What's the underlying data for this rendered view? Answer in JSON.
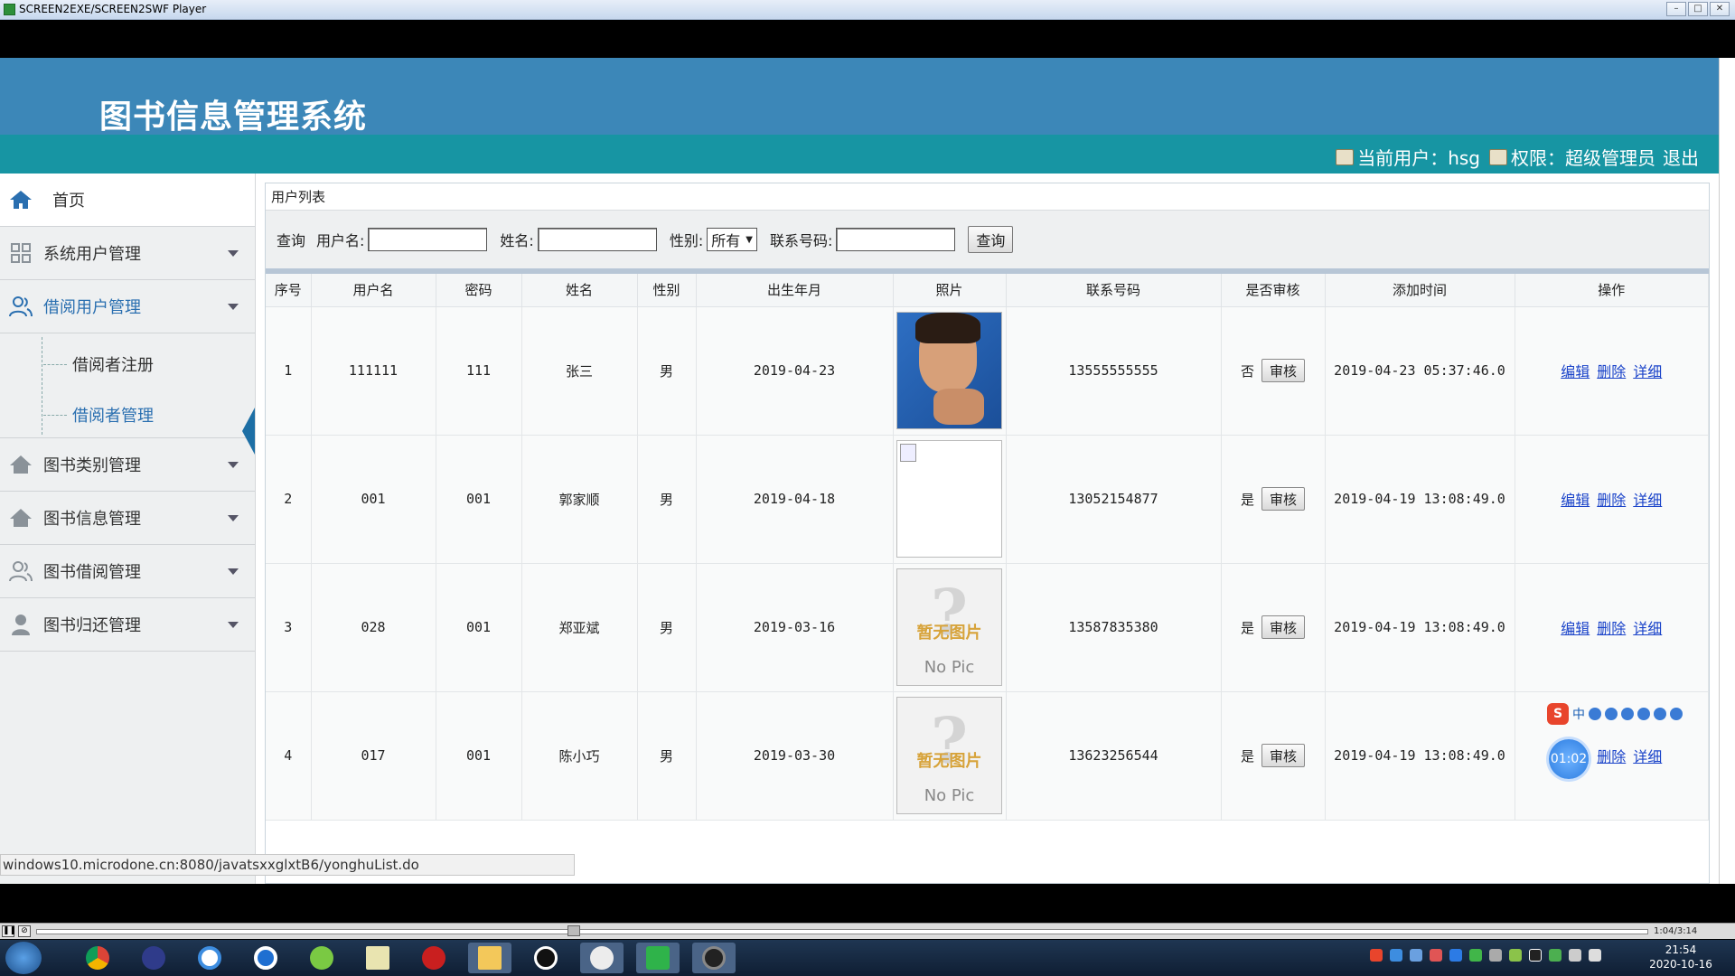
{
  "window": {
    "title": "SCREEN2EXE/SCREEN2SWF Player",
    "buttons": [
      "–",
      "□",
      "✕"
    ]
  },
  "header": {
    "system_title": "图书信息管理系统"
  },
  "userbar": {
    "current_user": "当前用户：hsg",
    "role": "权限：超级管理员",
    "logout": "退出"
  },
  "sidebar": {
    "home": "首页",
    "items": [
      {
        "label": "系统用户管理",
        "icon": "grid-icon"
      },
      {
        "label": "借阅用户管理",
        "icon": "users-icon"
      },
      {
        "label": "图书类别管理",
        "icon": "house-icon"
      },
      {
        "label": "图书信息管理",
        "icon": "house-icon"
      },
      {
        "label": "图书借阅管理",
        "icon": "users-icon"
      },
      {
        "label": "图书归还管理",
        "icon": "user-icon"
      }
    ],
    "subitems": [
      "借阅者注册",
      "借阅者管理"
    ],
    "active_subitem": "借阅者管理"
  },
  "panel": {
    "title": "用户列表",
    "search": {
      "prefix": "查询",
      "username_label": "用户名:",
      "name_label": "姓名:",
      "gender_label": "性别:",
      "gender_selected": "所有",
      "phone_label": "联系号码:",
      "button": "查询"
    },
    "columns": [
      "序号",
      "用户名",
      "密码",
      "姓名",
      "性别",
      "出生年月",
      "照片",
      "联系号码",
      "是否审核",
      "添加时间",
      "操作"
    ],
    "rows": [
      {
        "no": "1",
        "username": "111111",
        "password": "111",
        "name": "张三",
        "gender": "男",
        "birth": "2019-04-23",
        "photo": "face-photo",
        "phone": "13555555555",
        "audited": "否",
        "audit_btn": "审核",
        "added": "2019-04-23 05:37:46.0",
        "ops": [
          "编辑",
          "删除",
          "详细"
        ]
      },
      {
        "no": "2",
        "username": "001",
        "password": "001",
        "name": "郭家顺",
        "gender": "男",
        "birth": "2019-04-18",
        "photo": "broken-image",
        "phone": "13052154877",
        "audited": "是",
        "audit_btn": "审核",
        "added": "2019-04-19 13:08:49.0",
        "ops": [
          "编辑",
          "删除",
          "详细"
        ]
      },
      {
        "no": "3",
        "username": "028",
        "password": "001",
        "name": "郑亚斌",
        "gender": "男",
        "birth": "2019-03-16",
        "photo": "no-pic",
        "phone": "13587835380",
        "audited": "是",
        "audit_btn": "审核",
        "added": "2019-04-19 13:08:49.0",
        "ops": [
          "编辑",
          "删除",
          "详细"
        ]
      },
      {
        "no": "4",
        "username": "017",
        "password": "001",
        "name": "陈小巧",
        "gender": "男",
        "birth": "2019-03-30",
        "photo": "no-pic",
        "phone": "13623256544",
        "audited": "是",
        "audit_btn": "审核",
        "added": "2019-04-19 13:08:49.0",
        "ops": [
          "编辑",
          "删除",
          "详细"
        ]
      }
    ],
    "nopic_text_cn": "暂无图片",
    "nopic_text_en": "No Pic"
  },
  "status_url": "windows10.microdone.cn:8080/javatsxxglxtB6/yonghuList.do",
  "overlay": {
    "timer": "01:02",
    "ime_label": "中"
  },
  "player": {
    "time": "1:04/3:14"
  },
  "taskbar": {
    "time": "21:54",
    "date": "2020-10-16"
  },
  "colors": {
    "header_bg": "#3c87b8",
    "userbar_bg": "#1795a3",
    "link": "#1a43c9",
    "active": "#2a6fb0"
  }
}
